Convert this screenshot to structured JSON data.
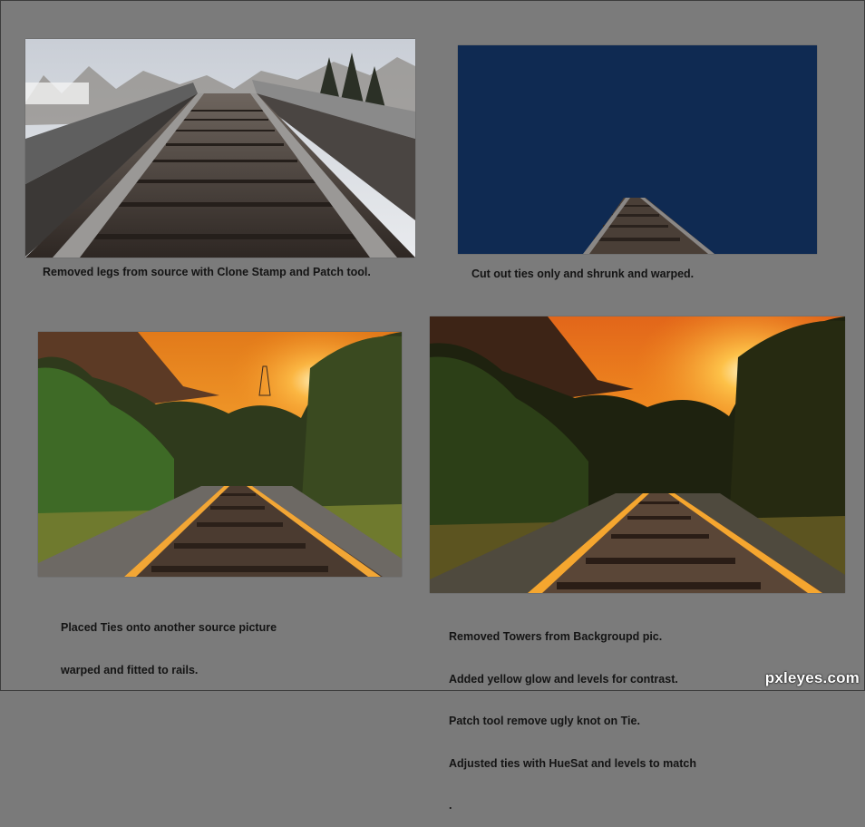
{
  "panels": {
    "top_left": {
      "caption": "Removed legs from source with Clone Stamp and Patch tool."
    },
    "top_right": {
      "caption": "Cut out ties only and shrunk and warped.",
      "background_color": "#0f2a52"
    },
    "bottom_left": {
      "caption_lines": [
        "Placed Ties onto another source picture",
        "warped and fitted to rails."
      ]
    },
    "bottom_right": {
      "caption_lines": [
        "Removed Towers from Backgroupd pic.",
        "Added yellow glow and levels for contrast.",
        "Patch tool remove ugly knot on Tie.",
        "Adjusted ties with HueSat and levels to match",
        "."
      ]
    }
  },
  "watermark": "pxleyes.com",
  "colors": {
    "page_background": "#7b7b7b",
    "caption_text": "#141414",
    "sunset_orange": "#f08a1e",
    "rail_glow": "#f2a635"
  }
}
